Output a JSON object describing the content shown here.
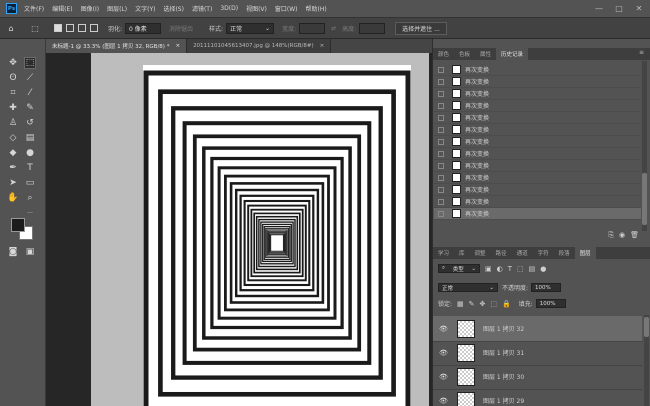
{
  "menubar": {
    "logo": "Ps",
    "items": [
      "文件(F)",
      "编辑(E)",
      "图像(I)",
      "图层(L)",
      "文字(Y)",
      "选择(S)",
      "滤镜(T)",
      "3D(D)",
      "视图(V)",
      "窗口(W)",
      "帮助(H)"
    ]
  },
  "options": {
    "feather_label": "羽化:",
    "feather_value": "0 像素",
    "antialias": "消除锯齿",
    "style_label": "样式:",
    "style_value": "正常",
    "width_label": "宽度:",
    "height_label": "高度:",
    "select_mask": "选择并遮住 ..."
  },
  "tabs": [
    "未标题-1 @ 33.3% (图层 1 拷贝 32, RGB/8) *",
    "20111101045613407.jpg @ 148%(RGB/8#)"
  ],
  "top_panel_tabs": [
    "颜色",
    "色板",
    "属性",
    "历史记录"
  ],
  "history": {
    "items": [
      "再次变换",
      "再次变换",
      "再次变换",
      "再次变换",
      "再次变换",
      "再次变换",
      "再次变换",
      "再次变换",
      "再次变换",
      "再次变换",
      "再次变换",
      "再次变换",
      "再次变换"
    ]
  },
  "bottom_panel_tabs": [
    "学习",
    "库",
    "调整",
    "路径",
    "通道",
    "字符",
    "段落",
    "图层"
  ],
  "layers_panel": {
    "filter_kind": "类型",
    "blend_mode": "正常",
    "opacity_label": "不透明度:",
    "opacity_value": "100%",
    "lock_label": "锁定:",
    "fill_label": "填充:",
    "fill_value": "100%",
    "layers": [
      "图层 1 拷贝 32",
      "图层 1 拷贝 31",
      "图层 1 拷贝 30",
      "图层 1 拷贝 29"
    ]
  },
  "colors": {
    "foreground": "#1c1c1c",
    "background": "#ffffff",
    "app_bg": "#535353",
    "canvas_bg": "#262626",
    "artboard_bg": "#bdbdbd",
    "stroke": "#1a1a1a"
  },
  "icons": {
    "home": "home-icon",
    "marquee": "rect-marquee-icon",
    "eye": "eye-icon"
  }
}
